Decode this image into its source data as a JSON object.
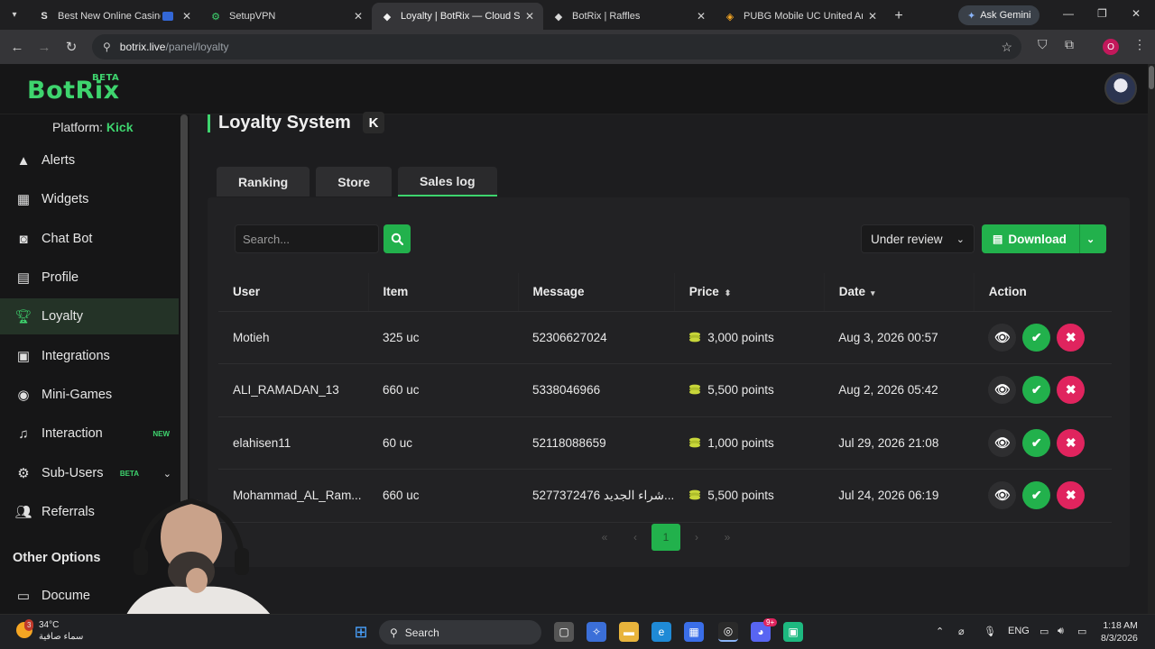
{
  "browser": {
    "tabs": [
      {
        "title": "Best New Online Casino G",
        "icon": "s-favicon",
        "active": false
      },
      {
        "title": "SetupVPN",
        "icon": "vpn-favicon",
        "active": false
      },
      {
        "title": "Loyalty | BotRix — Cloud Stre",
        "icon": "botrix-favicon",
        "active": true
      },
      {
        "title": "BotRix | Raffles",
        "icon": "botrix-favicon",
        "active": false
      },
      {
        "title": "PUBG Mobile UC United Arab",
        "icon": "pubg-favicon",
        "active": false
      }
    ],
    "gemini_label": "Ask Gemini",
    "url_host": "botrix.live",
    "url_path": "/panel/loyalty",
    "profile_initial": "O"
  },
  "app": {
    "logo": "BotRix",
    "logo_badge": "BETA"
  },
  "sidebar": {
    "platform_label": "Platform:",
    "platform_value": "Kick",
    "items": [
      {
        "label": "Alerts",
        "icon": "alert-triangle-icon"
      },
      {
        "label": "Widgets",
        "icon": "grid-icon"
      },
      {
        "label": "Chat Bot",
        "icon": "robot-icon"
      },
      {
        "label": "Profile",
        "icon": "id-card-icon"
      },
      {
        "label": "Loyalty",
        "icon": "trophy-icon",
        "active": true
      },
      {
        "label": "Integrations",
        "icon": "plug-icon"
      },
      {
        "label": "Mini-Games",
        "icon": "gamepad-icon"
      },
      {
        "label": "Interaction",
        "icon": "music-icon",
        "badge": "NEW"
      },
      {
        "label": "Sub-Users",
        "icon": "users-icon",
        "badge": "BETA"
      },
      {
        "label": "Referrals",
        "icon": "user-group-icon"
      }
    ],
    "other_heading": "Other Options",
    "docs_label": "Docume"
  },
  "page": {
    "title": "Loyalty System",
    "platform_badge": "K",
    "tabs": [
      "Ranking",
      "Store",
      "Sales log"
    ],
    "active_tab": "Sales log",
    "search_placeholder": "Search...",
    "filter_value": "Under review",
    "download_label": "Download",
    "columns": [
      "User",
      "Item",
      "Message",
      "Price",
      "Date",
      "Action"
    ],
    "rows": [
      {
        "user": "Motieh",
        "item": "325 uc",
        "message": "52306627024",
        "price": "3,000 points",
        "date": "Aug 3, 2026 00:57"
      },
      {
        "user": "ALI_RAMADAN_13",
        "item": "660 uc",
        "message": "5338046966",
        "price": "5,500 points",
        "date": "Aug 2, 2026 05:42"
      },
      {
        "user": "elahisen11",
        "item": "60 uc",
        "message": "52118088659",
        "price": "1,000 points",
        "date": "Jul 29, 2026 21:08"
      },
      {
        "user": "Mohammad_AL_Ram...",
        "item": "660 uc",
        "message": "5277372476 شراء الجديد...",
        "price": "5,500 points",
        "date": "Jul 24, 2026 06:19"
      }
    ],
    "pager": {
      "first": "«",
      "prev": "‹",
      "current": "1",
      "next": "›",
      "last": "»"
    }
  },
  "taskbar": {
    "temperature": "34°C",
    "weather_text": "سماء صافية",
    "weather_badge": "3",
    "search_label": "Search",
    "language": "ENG",
    "time": "1:18 AM",
    "date": "8/3/2026",
    "discord_badge": "9+"
  },
  "colors": {
    "accent": "#3ed46e",
    "button_green": "#22b14c",
    "reject_red": "#e0245e",
    "sidebar_bg": "#161617",
    "main_bg": "#1d1d1f"
  }
}
